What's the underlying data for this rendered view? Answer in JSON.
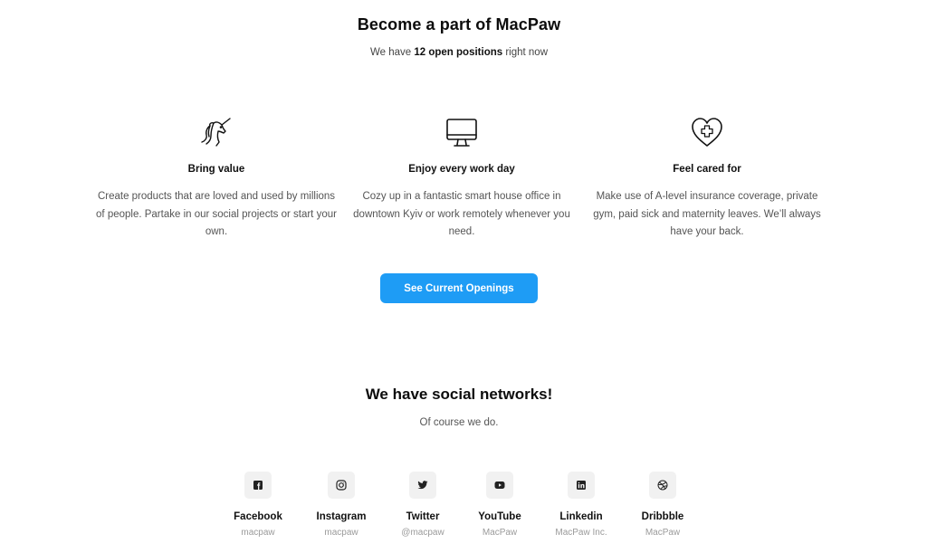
{
  "hero": {
    "title": "Become a part of MacPaw",
    "sub_prefix": "We have ",
    "sub_bold": "12 open positions",
    "sub_suffix": " right now"
  },
  "features": [
    {
      "icon": "unicorn-icon",
      "title": "Bring value",
      "text": "Create products that are loved and used by millions of people. Partake in our social projects or start your own."
    },
    {
      "icon": "monitor-icon",
      "title": "Enjoy every work day",
      "text": "Cozy up in a fantastic smart house office in downtown Kyiv or work remotely whenever you need."
    },
    {
      "icon": "heart-plus-icon",
      "title": "Feel cared for",
      "text": "Make use of A-level insurance coverage, private gym, paid sick and maternity leaves. We’ll always have your back."
    }
  ],
  "cta": {
    "label": "See Current Openings",
    "color": "#1e9cf5"
  },
  "social": {
    "title": "We have social networks!",
    "subtitle": "Of course we do.",
    "networks": [
      {
        "icon": "facebook-icon",
        "name": "Facebook",
        "handle": "macpaw"
      },
      {
        "icon": "instagram-icon",
        "name": "Instagram",
        "handle": "macpaw"
      },
      {
        "icon": "twitter-icon",
        "name": "Twitter",
        "handle": "@macpaw"
      },
      {
        "icon": "youtube-icon",
        "name": "YouTube",
        "handle": "MacPaw"
      },
      {
        "icon": "linkedin-icon",
        "name": "Linkedin",
        "handle": "MacPaw Inc."
      },
      {
        "icon": "dribbble-icon",
        "name": "Dribbble",
        "handle": "MacPaw"
      }
    ]
  }
}
